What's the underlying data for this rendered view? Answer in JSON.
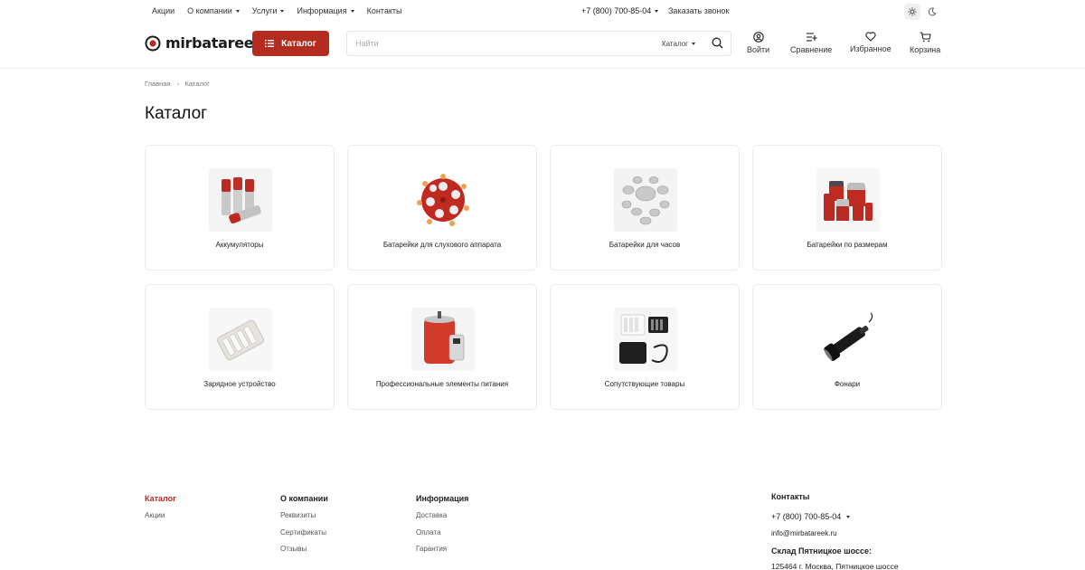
{
  "topbar": {
    "nav": [
      {
        "label": "Акции",
        "dropdown": false
      },
      {
        "label": "О компании",
        "dropdown": true
      },
      {
        "label": "Услуги",
        "dropdown": true
      },
      {
        "label": "Информация",
        "dropdown": true
      },
      {
        "label": "Контакты",
        "dropdown": false
      }
    ],
    "phone": "+7 (800) 700-85-04",
    "callback": "Заказать звонок",
    "theme_icons": [
      "sun-icon",
      "moon-icon"
    ]
  },
  "header": {
    "logo_text": "mirbatareek",
    "catalog_button": "Каталог",
    "search_placeholder": "Найти",
    "search_scope": "Каталог",
    "actions": [
      {
        "label": "Войти",
        "icon": "user-icon"
      },
      {
        "label": "Сравнение",
        "icon": "compare-icon"
      },
      {
        "label": "Избранное",
        "icon": "heart-icon"
      },
      {
        "label": "Корзина",
        "icon": "cart-icon"
      }
    ]
  },
  "breadcrumb": [
    "Главная",
    "Каталог"
  ],
  "page_title": "Каталог",
  "categories": [
    {
      "name": "Аккумуляторы",
      "icon": "aa-batteries-image"
    },
    {
      "name": "Батарейки для слухового аппарата",
      "icon": "hearing-aid-batteries-image"
    },
    {
      "name": "Батарейки для часов",
      "icon": "coin-cell-batteries-image"
    },
    {
      "name": "Батарейки по размерам",
      "icon": "battery-sizes-image"
    },
    {
      "name": "Зарядное устройство",
      "icon": "charger-image"
    },
    {
      "name": "Профессиональные элементы питания",
      "icon": "pro-batteries-image"
    },
    {
      "name": "Сопутствующие товары",
      "icon": "accessories-image"
    },
    {
      "name": "Фонари",
      "icon": "flashlight-image"
    }
  ],
  "footer": {
    "catalog": {
      "head": "Каталог",
      "links": [
        "Акции"
      ]
    },
    "about": {
      "head": "О компании",
      "links": [
        "Реквизиты",
        "Сертификаты",
        "Отзывы"
      ]
    },
    "info": {
      "head": "Информация",
      "links": [
        "Доставка",
        "Оплата",
        "Гарантия"
      ]
    },
    "contacts": {
      "head": "Контакты",
      "phone": "+7 (800) 700-85-04",
      "email": "info@mirbatareek.ru",
      "address_title": "Склад Пятницкое шоссе:",
      "address": "125464 г. Москва, Пятницкое шоссе"
    }
  },
  "colors": {
    "accent": "#b32c1f",
    "text": "#222222",
    "border": "#ececec"
  }
}
